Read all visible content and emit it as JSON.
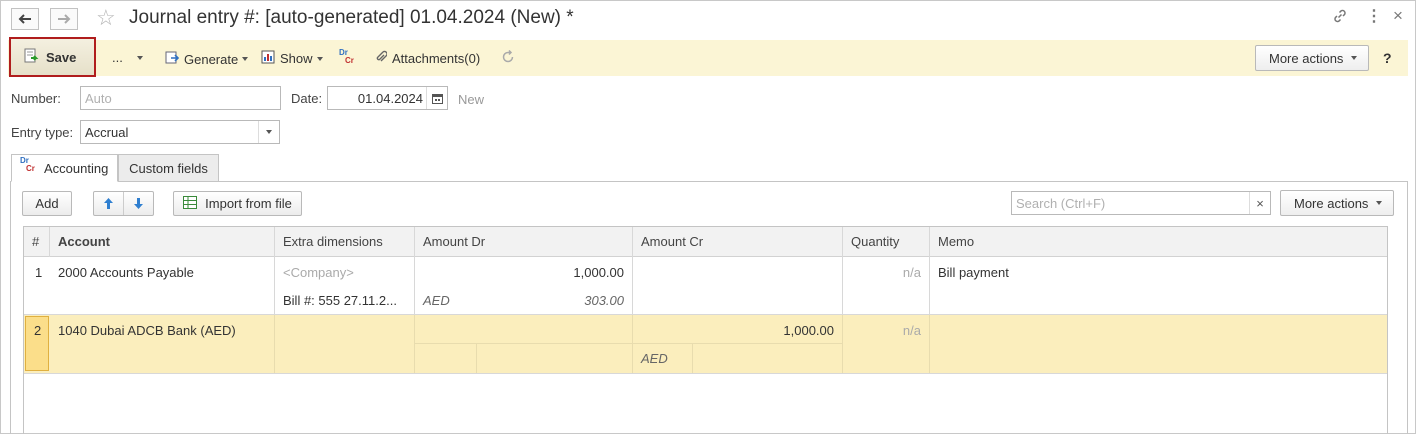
{
  "window": {
    "title": "Journal entry #: [auto-generated] 01.04.2024 (New) *"
  },
  "toolbar": {
    "save_label": "Save",
    "more_dots": "...",
    "generate_label": "Generate",
    "show_label": "Show",
    "attachments_label": "Attachments(0)",
    "more_actions_label": "More actions",
    "help_label": "?"
  },
  "form": {
    "number_label": "Number:",
    "number_placeholder": "Auto",
    "date_label": "Date:",
    "date_value": "01.04.2024",
    "status": "New",
    "entry_type_label": "Entry type:",
    "entry_type_value": "Accrual"
  },
  "tabs": [
    {
      "label": "Accounting",
      "active": true
    },
    {
      "label": "Custom fields",
      "active": false
    }
  ],
  "grid_toolbar": {
    "add_label": "Add",
    "import_label": "Import from file",
    "search_placeholder": "Search (Ctrl+F)",
    "clear_label": "×",
    "more_actions_label": "More actions"
  },
  "table": {
    "columns": [
      "#",
      "Account",
      "Extra dimensions",
      "Amount Dr",
      "Amount Cr",
      "Quantity",
      "Memo"
    ],
    "rows": [
      {
        "num": "1",
        "account": "2000 Accounts Payable",
        "extra1": "<Company>",
        "extra2": "Bill #: 555 27.11.2...",
        "amount_dr": "1,000.00",
        "currency_dr": "AED",
        "currency_amount_dr": "303.00",
        "amount_cr": "",
        "quantity": "n/a",
        "memo": "Bill payment"
      },
      {
        "num": "2",
        "account": "1040 Dubai ADCB Bank (AED)",
        "amount_dr": "",
        "amount_cr": "1,000.00",
        "currency_cr": "AED",
        "quantity": "n/a",
        "memo": "",
        "selected": true
      }
    ]
  },
  "icons": {
    "drcr_top": "Dr",
    "drcr_bottom": "Cr"
  },
  "colors": {
    "command_bar": "#fbf5d5",
    "selected_row": "#fbeebd",
    "save_outline": "#b01d1d"
  }
}
